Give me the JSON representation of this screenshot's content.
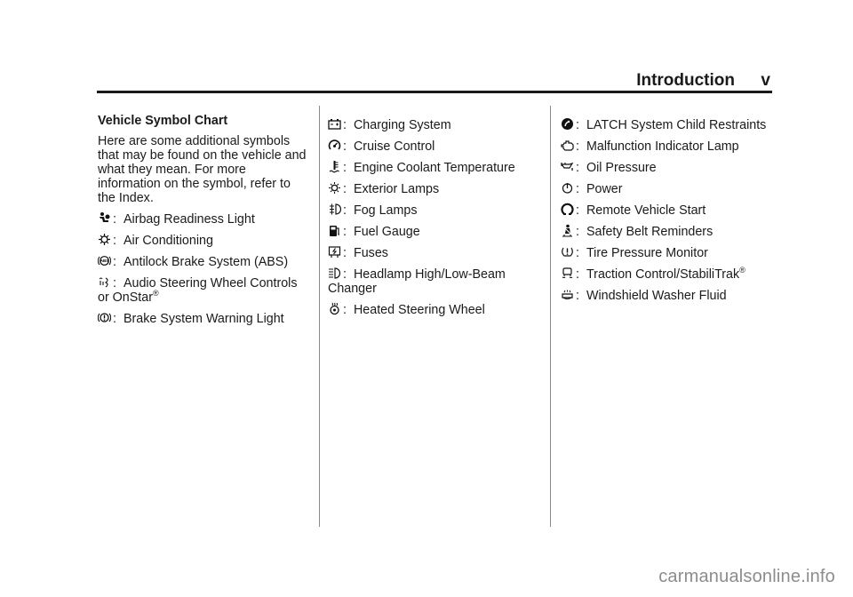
{
  "header": {
    "title": "Introduction",
    "page": "v"
  },
  "section": {
    "title": "Vehicle Symbol Chart",
    "intro": "Here are some additional symbols that may be found on the vehicle and what they mean. For more information on the symbol, refer to the Index."
  },
  "columns": [
    [
      {
        "icon": "airbag-icon",
        "label": "Airbag Readiness Light"
      },
      {
        "icon": "air-conditioning-icon",
        "label": "Air Conditioning"
      },
      {
        "icon": "abs-icon",
        "label": "Antilock Brake System (ABS)"
      },
      {
        "icon": "audio-steering-wheel-icon",
        "label": "Audio Steering Wheel Controls or OnStar",
        "sup": "®"
      },
      {
        "icon": "brake-warning-icon",
        "label": "Brake System Warning Light"
      }
    ],
    [
      {
        "icon": "battery-icon",
        "label": "Charging System"
      },
      {
        "icon": "cruise-control-icon",
        "label": "Cruise Control"
      },
      {
        "icon": "coolant-temperature-icon",
        "label": "Engine Coolant Temperature"
      },
      {
        "icon": "exterior-lamps-icon",
        "label": "Exterior Lamps"
      },
      {
        "icon": "fog-lamps-icon",
        "label": "Fog Lamps"
      },
      {
        "icon": "fuel-gauge-icon",
        "label": "Fuel Gauge"
      },
      {
        "icon": "fuses-icon",
        "label": "Fuses"
      },
      {
        "icon": "headlamp-beam-icon",
        "label": "Headlamp High/Low-Beam Changer"
      },
      {
        "icon": "heated-steering-wheel-icon",
        "label": "Heated Steering Wheel"
      }
    ],
    [
      {
        "icon": "latch-child-restraint-icon",
        "label": "LATCH System Child Restraints"
      },
      {
        "icon": "check-engine-icon",
        "label": "Malfunction Indicator Lamp"
      },
      {
        "icon": "oil-pressure-icon",
        "label": "Oil Pressure"
      },
      {
        "icon": "power-icon",
        "label": "Power"
      },
      {
        "icon": "remote-start-icon",
        "label": "Remote Vehicle Start"
      },
      {
        "icon": "safety-belt-icon",
        "label": "Safety Belt Reminders"
      },
      {
        "icon": "tire-pressure-icon",
        "label": "Tire Pressure Monitor"
      },
      {
        "icon": "traction-control-icon",
        "label": "Traction Control/StabiliTrak",
        "sup": "®"
      },
      {
        "icon": "washer-fluid-icon",
        "label": "Windshield Washer Fluid"
      }
    ]
  ],
  "separator": ":",
  "watermark": "carmanualsonline.info"
}
